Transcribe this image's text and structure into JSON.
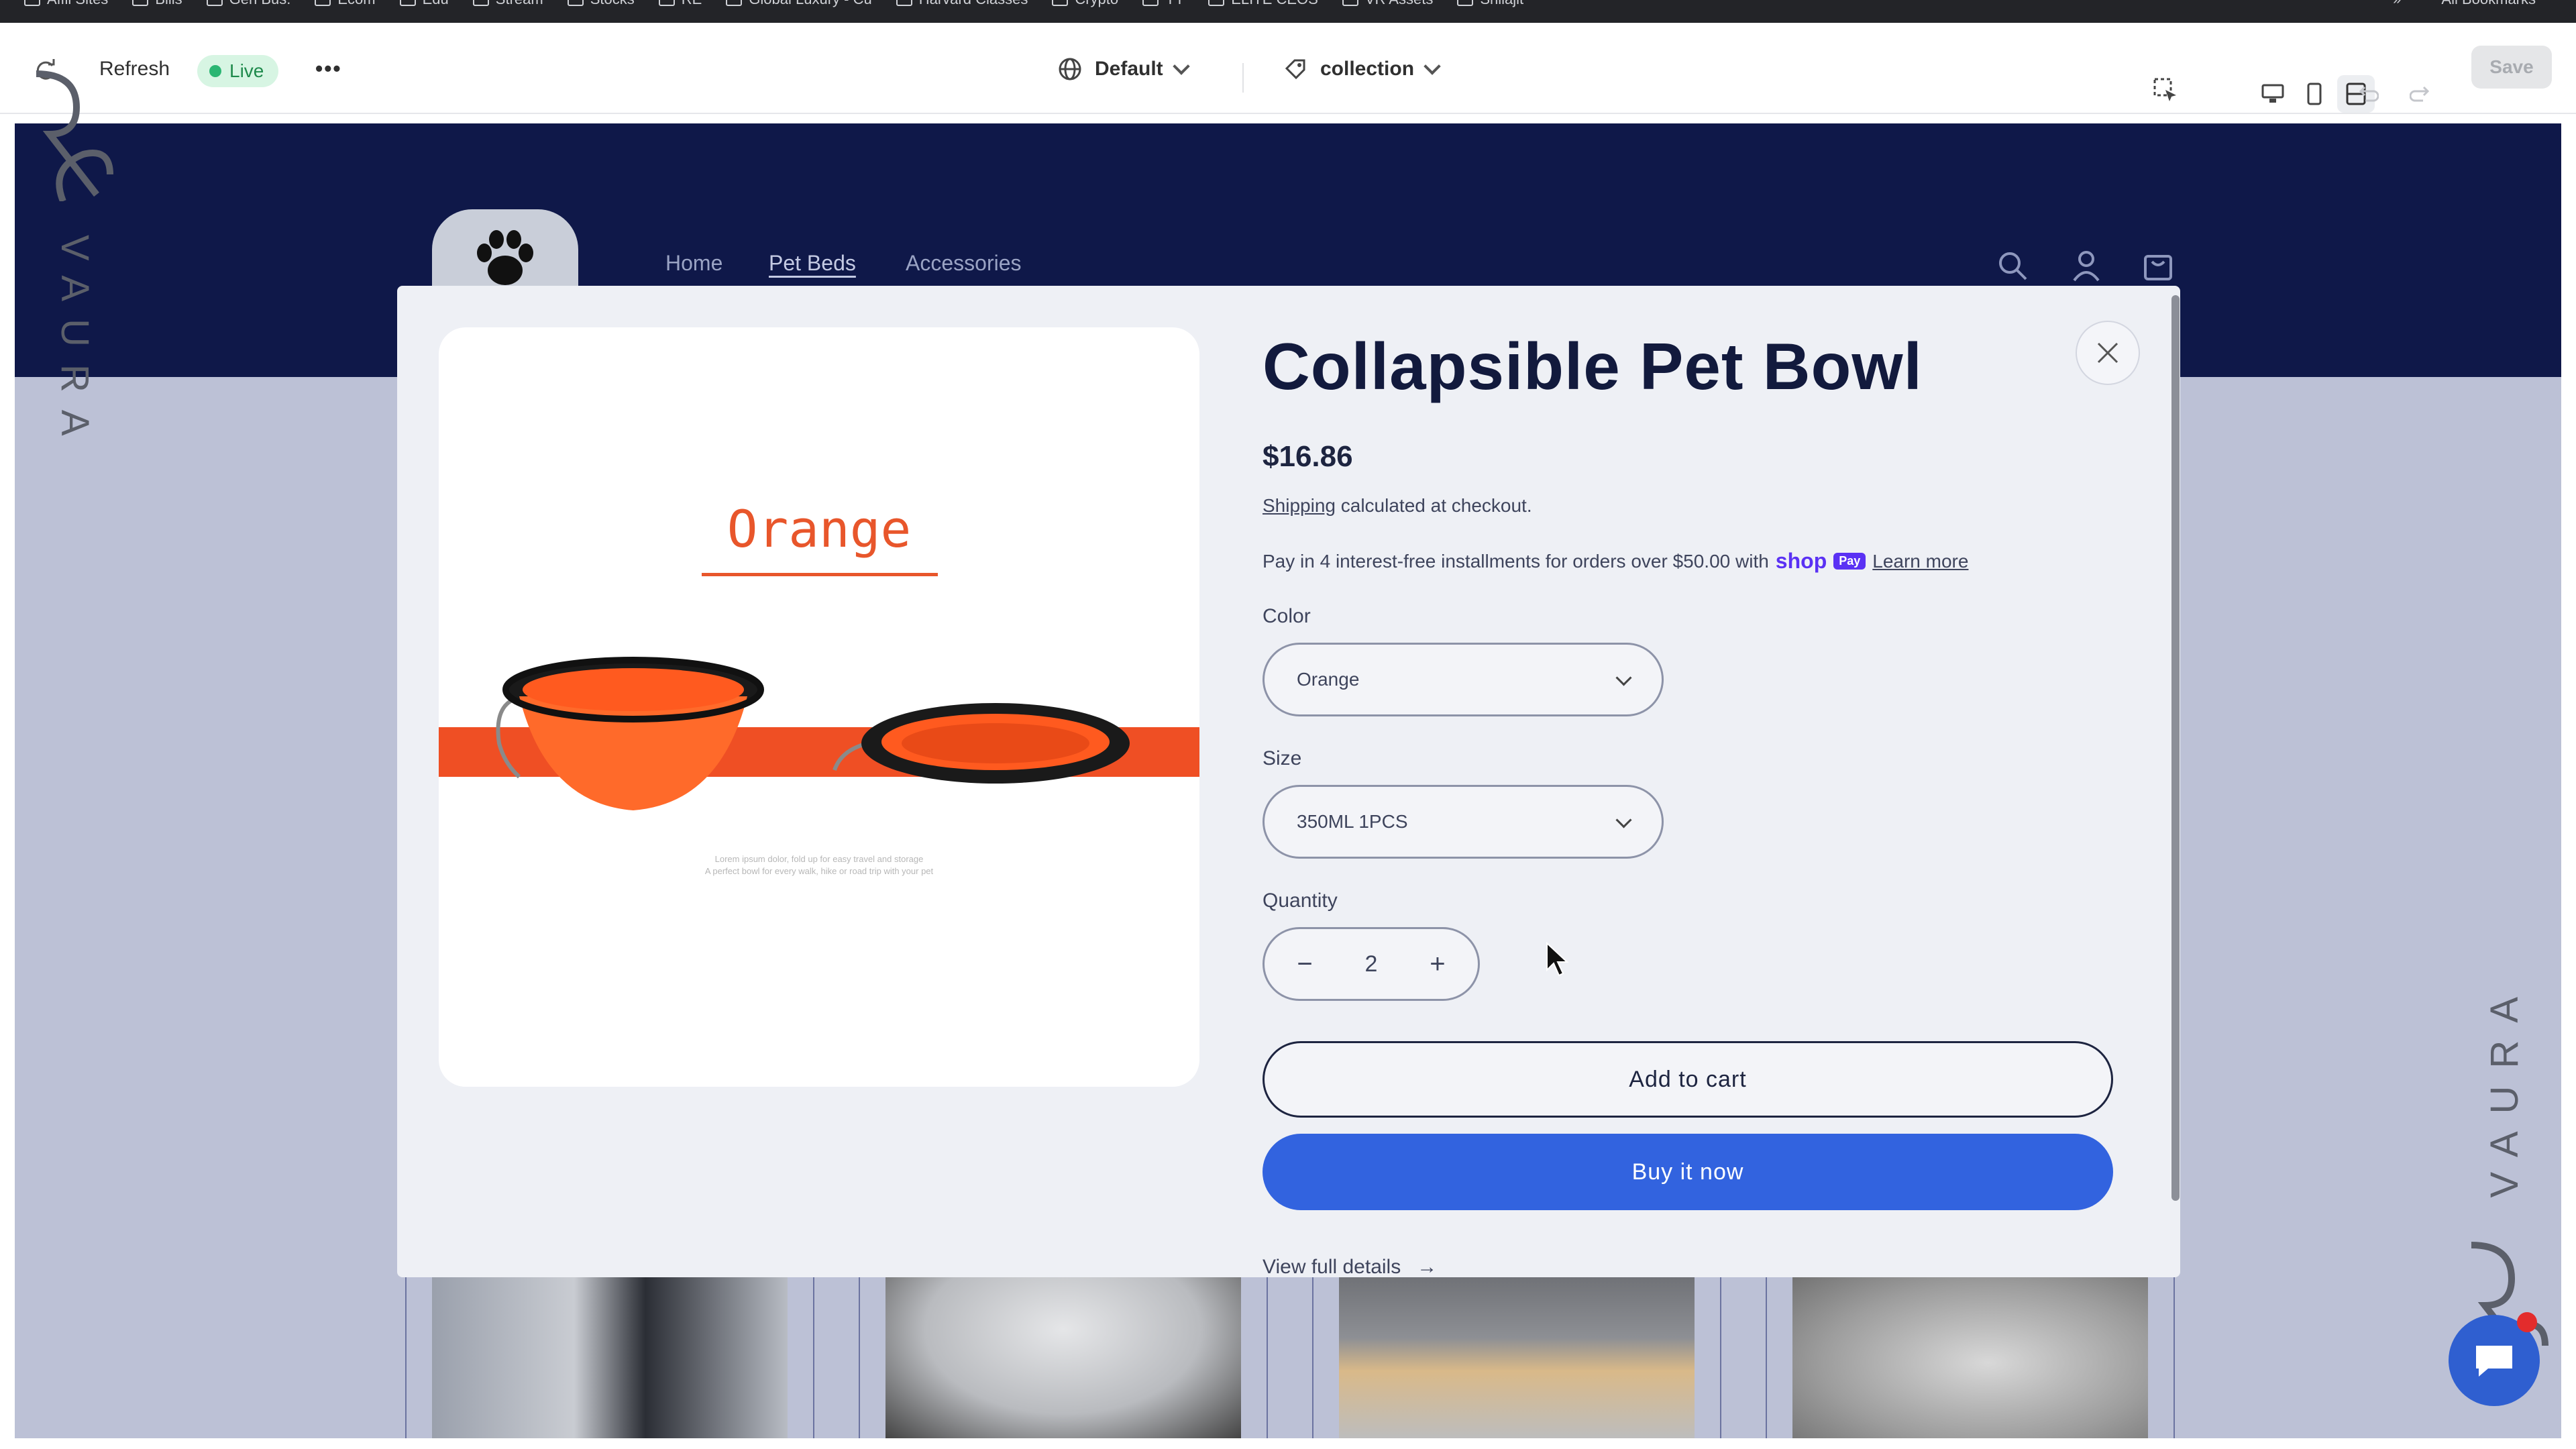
{
  "bookmarks": {
    "items": [
      "Affil Sites",
      "Bills",
      "Gen Bus.",
      "Ecom",
      "Edu",
      "Stream",
      "Stocks",
      "RE",
      "Global Luxury - Cu",
      "Harvard Classes",
      "Crypto",
      "YT",
      "ELITE CEOS",
      "VR Assets",
      "Shilajit"
    ],
    "overflow": "»",
    "all_bookmarks": "All Bookmarks"
  },
  "toolbar": {
    "refresh_label": "Refresh",
    "live_label": "Live",
    "more_label": "•••",
    "theme_label": "Default",
    "template_label": "collection",
    "save_label": "Save"
  },
  "store": {
    "nav": [
      "Home",
      "Pet Beds",
      "Accessories"
    ],
    "active_nav": "Pet Beds"
  },
  "product": {
    "image_caption": "Orange",
    "image_fine_print_1": "Lorem ipsum dolor, fold up for easy travel and storage",
    "image_fine_print_2": "A perfect bowl for every walk, hike or road trip with your pet",
    "title": "Collapsible Pet Bowl",
    "price": "$16.86",
    "shipping_link": "Shipping",
    "shipping_rest": "calculated at checkout.",
    "installments_text": "Pay in 4 interest-free installments for orders over $50.00 with",
    "shop_logo": "shop",
    "shop_pay": "Pay",
    "learn_more": "Learn more",
    "color_label": "Color",
    "color_value": "Orange",
    "size_label": "Size",
    "size_value": "350ML 1PCS",
    "quantity_label": "Quantity",
    "quantity_value": "2",
    "minus": "−",
    "plus": "+",
    "add_to_cart": "Add to cart",
    "buy_now": "Buy it now",
    "view_details": "View full details",
    "arrow": "→"
  },
  "watermark": {
    "brand": "VAURA"
  },
  "colors": {
    "header_navy": "#0f1849",
    "accent_blue": "#3263df",
    "product_orange": "#ef4f24",
    "live_green": "#2bb673"
  },
  "icons": [
    "refresh-icon",
    "globe-icon",
    "template-icon",
    "inspector-icon",
    "desktop-icon",
    "mobile-icon",
    "fullwidth-icon",
    "undo-icon",
    "redo-icon",
    "paw-icon",
    "search-icon",
    "account-icon",
    "cart-icon",
    "close-icon",
    "cursor-icon",
    "chat-icon"
  ]
}
